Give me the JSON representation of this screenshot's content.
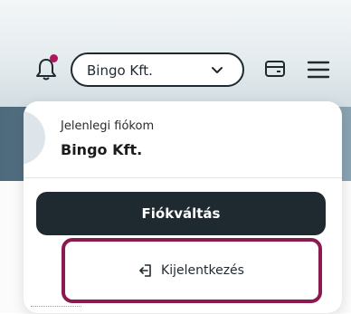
{
  "header": {
    "account_select_value": "Bingo Kft.",
    "icons": [
      "bell-icon",
      "chevron-down-icon",
      "card-icon",
      "menu-icon"
    ],
    "notification_dot_color": "#b0165c"
  },
  "account_panel": {
    "current_account_label": "Jelenlegi fiókom",
    "current_account_name": "Bingo Kft.",
    "switch_button_label": "Fiókváltás",
    "logout_label": "Kijelentkezés",
    "highlight_color": "#8a1b4e"
  }
}
